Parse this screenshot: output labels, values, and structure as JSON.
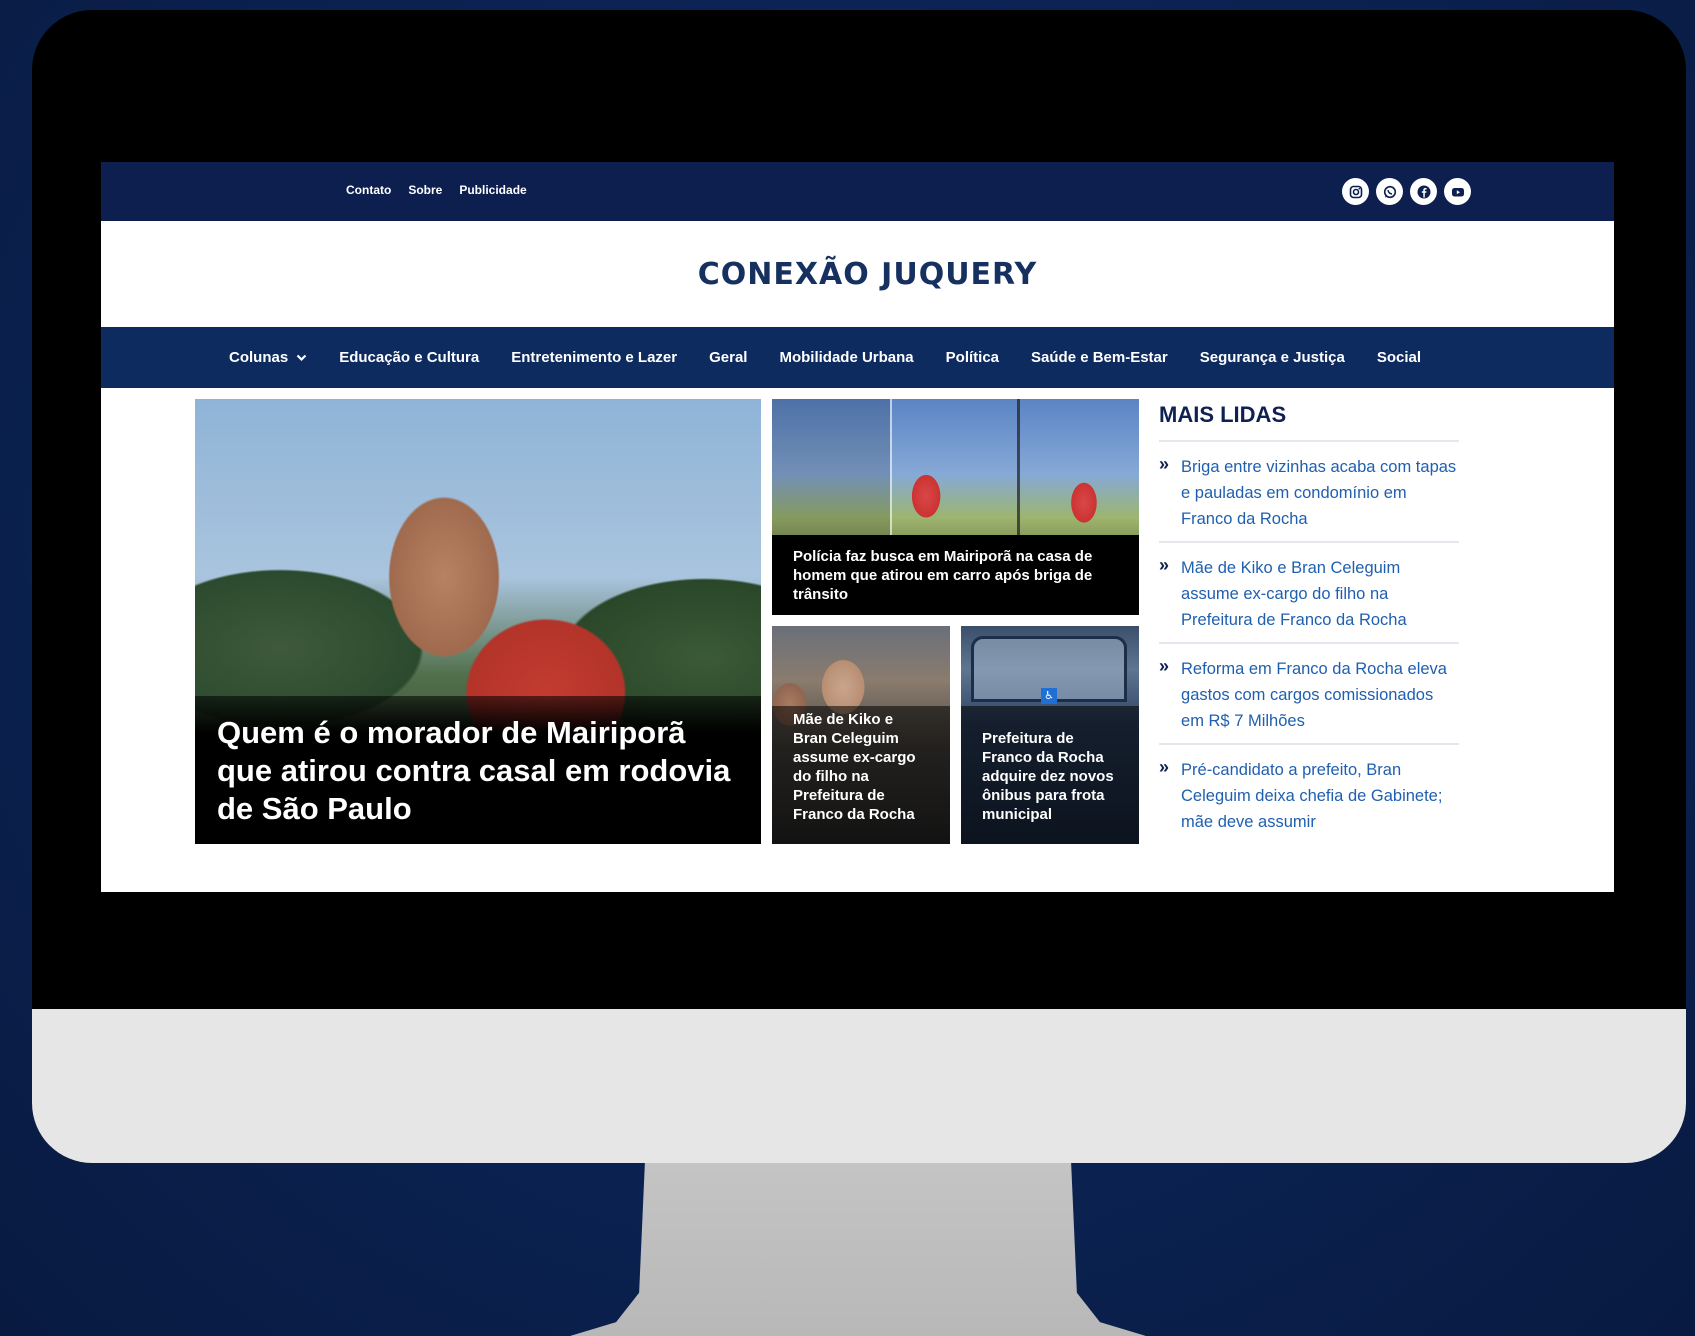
{
  "topbar": {
    "links": [
      "Contato",
      "Sobre",
      "Publicidade"
    ],
    "social_icons": [
      "instagram-icon",
      "whatsapp-icon",
      "facebook-icon",
      "youtube-icon"
    ]
  },
  "site": {
    "logo": "CONEXÃO JUQUERY"
  },
  "nav": {
    "items": [
      "Colunas",
      "Educação e Cultura",
      "Entretenimento e Lazer",
      "Geral",
      "Mobilidade Urbana",
      "Política",
      "Saúde e Bem-Estar",
      "Segurança e Justiça",
      "Social"
    ]
  },
  "featured": {
    "main_title": "Quem é o morador de Mairiporã que atirou contra casal em rodovia de São Paulo",
    "card_b_title": "Polícia faz busca em Mairiporã na casa de homem que atirou em carro após briga de trânsito",
    "card_c_title": "Mãe de Kiko e Bran Celeguim assume ex-cargo do filho na Prefeitura de Franco da Rocha",
    "card_d_title": "Prefeitura de Franco da Rocha adquire dez novos ônibus para frota municipal"
  },
  "sidebar": {
    "title": "MAIS LIDAS",
    "bullet": "»",
    "items": [
      "Briga entre vizinhas acaba com tapas e pauladas em condomínio em Franco da Rocha",
      "Mãe de Kiko e Bran Celeguim assume ex-cargo do filho na Prefeitura de Franco da Rocha",
      "Reforma em Franco da Rocha eleva gastos com cargos comissionados em R$ 7 Milhões",
      "Pré-candidato a prefeito, Bran Celeguim deixa chefia de Gabinete; mãe deve assumir"
    ]
  },
  "colors": {
    "topbar": "#0c1f4f",
    "navbar": "#0e2b60",
    "logo": "#16305f",
    "link": "#1f5fb0"
  }
}
